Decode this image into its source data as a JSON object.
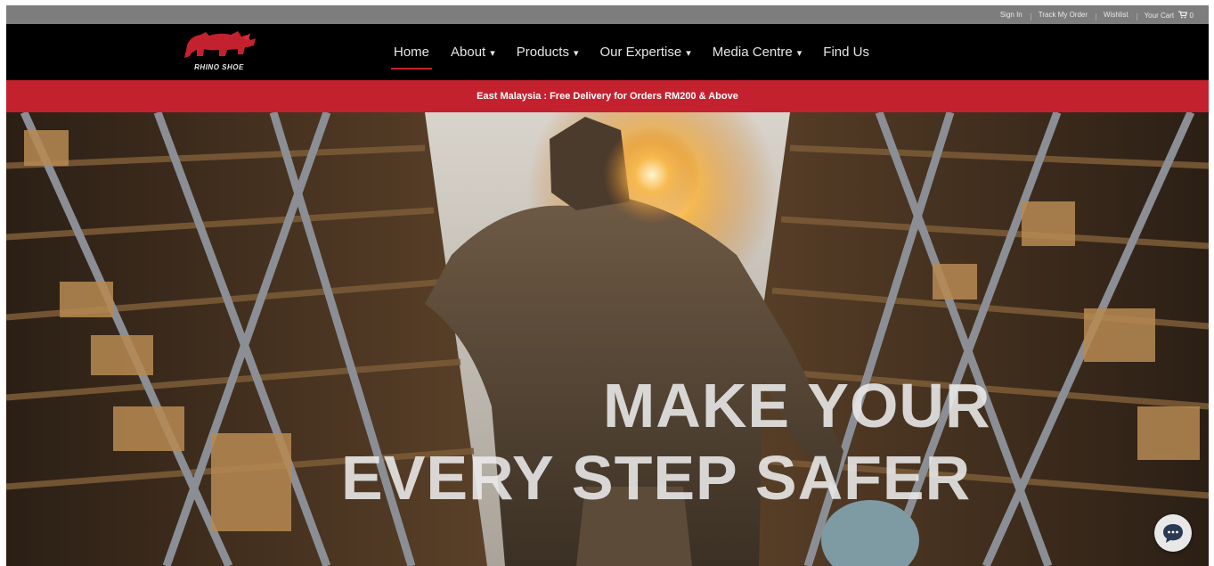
{
  "utility": {
    "sign_in": "Sign In",
    "track_order": "Track My Order",
    "wishlist": "Wishlist",
    "cart": "Your Cart",
    "cart_count": "0"
  },
  "brand": {
    "logo_text": "RHINO SHOE",
    "accent_color": "#c4212f"
  },
  "nav": {
    "items": [
      {
        "label": "Home",
        "has_dropdown": false,
        "active": true
      },
      {
        "label": "About",
        "has_dropdown": true
      },
      {
        "label": "Products",
        "has_dropdown": true
      },
      {
        "label": "Our Expertise",
        "has_dropdown": true
      },
      {
        "label": "Media Centre",
        "has_dropdown": true
      },
      {
        "label": "Find Us",
        "has_dropdown": false
      }
    ],
    "caret": "▾"
  },
  "promo": {
    "text": "East Malaysia : Free Delivery for Orders RM200 & Above"
  },
  "hero": {
    "headline_line1": "MAKE YOUR",
    "headline_line2": "EVERY STEP SAFER"
  },
  "icons": {
    "cart": "cart-icon",
    "chat": "chat-bubble-icon",
    "logo": "rhino-icon"
  }
}
